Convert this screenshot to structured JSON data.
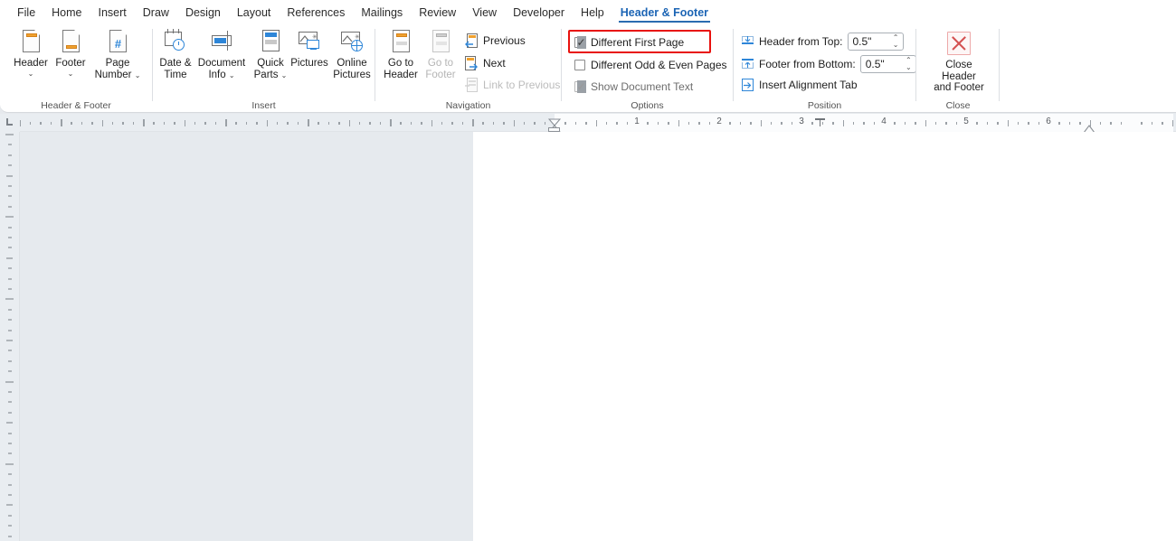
{
  "tabs": [
    {
      "label": "File",
      "active": false
    },
    {
      "label": "Home",
      "active": false
    },
    {
      "label": "Insert",
      "active": false
    },
    {
      "label": "Draw",
      "active": false
    },
    {
      "label": "Design",
      "active": false
    },
    {
      "label": "Layout",
      "active": false
    },
    {
      "label": "References",
      "active": false
    },
    {
      "label": "Mailings",
      "active": false
    },
    {
      "label": "Review",
      "active": false
    },
    {
      "label": "View",
      "active": false
    },
    {
      "label": "Developer",
      "active": false
    },
    {
      "label": "Help",
      "active": false
    },
    {
      "label": "Header & Footer",
      "active": true
    }
  ],
  "ribbon": {
    "groups": [
      {
        "name": "header_footer",
        "label": "Header & Footer"
      },
      {
        "name": "insert",
        "label": "Insert"
      },
      {
        "name": "navigation",
        "label": "Navigation"
      },
      {
        "name": "options",
        "label": "Options"
      },
      {
        "name": "position",
        "label": "Position"
      },
      {
        "name": "close",
        "label": "Close"
      }
    ],
    "header_footer": {
      "header": {
        "label": "Header",
        "chevron": "⌄"
      },
      "footer": {
        "label": "Footer",
        "chevron": "⌄"
      },
      "page_number": {
        "label_line1": "Page",
        "label_line2": "Number",
        "chevron": "⌄"
      }
    },
    "insert": {
      "date_time": {
        "label_line1": "Date &",
        "label_line2": "Time"
      },
      "document_info": {
        "label_line1": "Document",
        "label_line2": "Info",
        "chevron": "⌄"
      },
      "quick_parts": {
        "label_line1": "Quick",
        "label_line2": "Parts",
        "chevron": "⌄"
      },
      "pictures": {
        "label": "Pictures"
      },
      "online_pictures": {
        "label_line1": "Online",
        "label_line2": "Pictures"
      }
    },
    "navigation": {
      "go_to_header": {
        "label_line1": "Go to",
        "label_line2": "Header",
        "disabled": false
      },
      "go_to_footer": {
        "label_line1": "Go to",
        "label_line2": "Footer",
        "disabled": true
      },
      "previous": {
        "label": "Previous",
        "disabled": false
      },
      "next": {
        "label": "Next",
        "disabled": false
      },
      "link_to_previous": {
        "label": "Link to Previous",
        "disabled": true
      }
    },
    "options": {
      "different_first_page": {
        "label": "Different First Page",
        "checked": true,
        "highlighted": true
      },
      "different_odd_even": {
        "label": "Different Odd & Even Pages",
        "checked": false
      },
      "show_document_text": {
        "label": "Show Document Text",
        "checked": true,
        "dimmed": true
      }
    },
    "position": {
      "header_from_top": {
        "label": "Header from Top:",
        "value": "0.5\""
      },
      "footer_from_bottom": {
        "label": "Footer from Bottom:",
        "value": "0.5\""
      },
      "insert_alignment_tab": {
        "label": "Insert Alignment Tab"
      }
    },
    "close": {
      "close_header_footer": {
        "label_line1": "Close Header",
        "label_line2": "and Footer"
      }
    }
  },
  "ruler": {
    "numbers": [
      "1",
      "2",
      "3",
      "4",
      "5",
      "6"
    ],
    "unit": "inch",
    "tab_selector": "left-tab-stop"
  },
  "colors": {
    "accent": "#2b6cb0",
    "highlight": "#e8120e",
    "icon_orange": "#f0a12e",
    "icon_blue": "#2e86d8",
    "ribbon_bg": "#ffffff",
    "canvas_bg": "#e6eaee"
  }
}
